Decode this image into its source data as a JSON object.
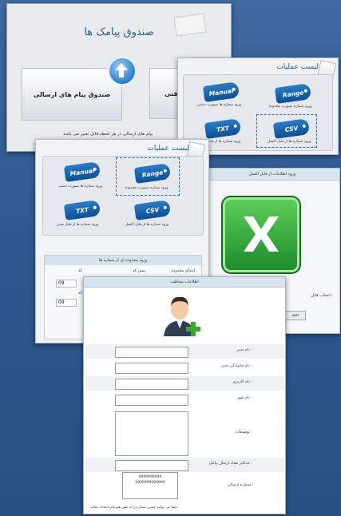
{
  "inbox": {
    "title": "صندوق پیامک ها",
    "sent_label": "صندوق پیام های ارسالی",
    "received_label": "یافتی",
    "note": "پیام های ارسالی در هر لحظه قابل تغییر می باشد"
  },
  "operations": {
    "title": "لیست عملیات",
    "items": [
      {
        "tag": "Manual",
        "label": "ورود شماره ها بصورت دستی"
      },
      {
        "tag": "Range",
        "label": "ورود شماره بصورت محدوده"
      },
      {
        "tag": "TXT",
        "label": "ورود شماره ها از فایل متنی"
      },
      {
        "tag": "CSV",
        "label": "ورود شماره ها از فایل اکسل"
      }
    ]
  },
  "range": {
    "header": "ورود محدوده ای از شماره ها",
    "col_start": "ابتدای محدوده",
    "col_end": "پیش کد",
    "suffix_a": "کد",
    "suffix_b": "کد",
    "value_a": "09",
    "value_b": "09"
  },
  "excel": {
    "header": "ورود اطلاعات از فایل اکسل",
    "file_label": "انتخاب فایل :",
    "button_label": "مرور"
  },
  "contact": {
    "header": "اطلاعات مخاطب",
    "fields": [
      {
        "label": "نام مدیر :"
      },
      {
        "label": "نام خانوادگی مدیر :"
      },
      {
        "label": "نام کاربری :"
      },
      {
        "label": "نام شهر :"
      }
    ],
    "description_label": "توضیحات :",
    "max_label": "حداکثر تعداد ارسال پیامک :",
    "list_label": "شماره ارسالی :",
    "list_values": [
      "9999999999",
      "9999999999999"
    ],
    "tip": "شما می توانید چندین شماره را به طور همزمان انتخاب نمائید."
  }
}
